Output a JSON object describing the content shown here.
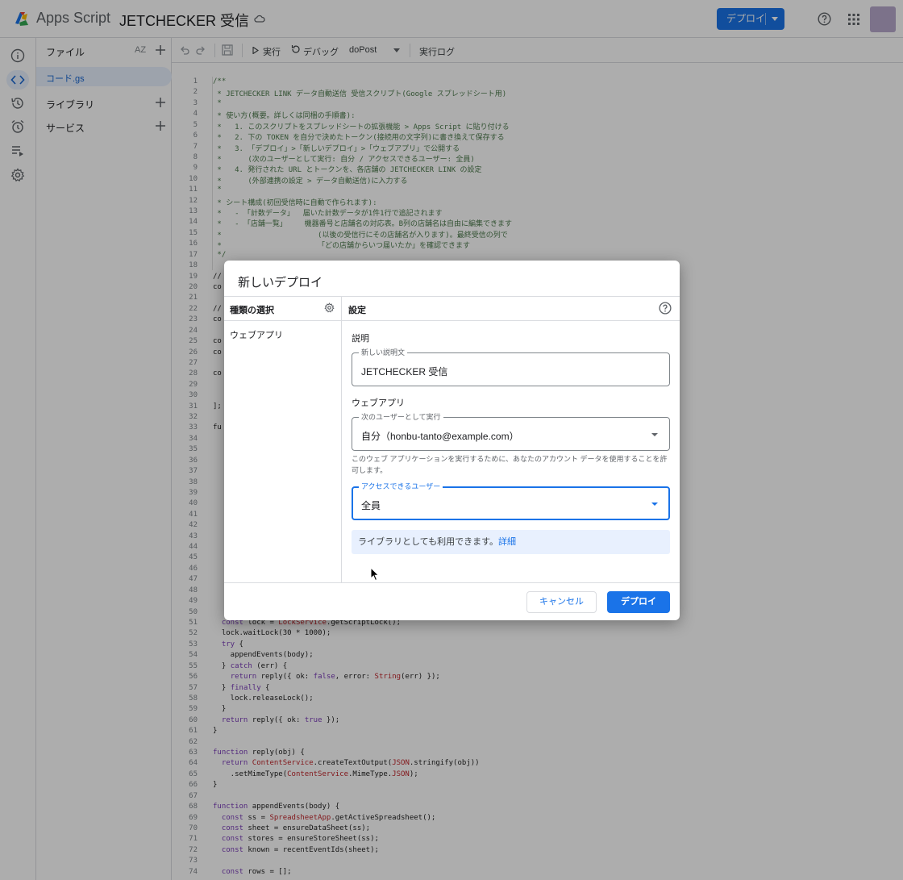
{
  "app": {
    "name": "Apps Script",
    "project_title": "JETCHECKER 受信"
  },
  "topbar": {
    "deploy_label": "デプロイ"
  },
  "file_panel": {
    "files_label": "ファイル",
    "sort_label": "AZ",
    "current_file": "コード.gs",
    "libraries_label": "ライブラリ",
    "services_label": "サービス"
  },
  "toolbar": {
    "run_label": "実行",
    "debug_label": "デバッグ",
    "function_name": "doPost",
    "log_label": "実行ログ"
  },
  "code": {
    "header_lines": [
      {
        "n": "1",
        "t": "/**"
      },
      {
        "n": "2",
        "t": " * JETCHECKER LINK データ自動送信 受信スクリプト(Google スプレッドシート用)"
      },
      {
        "n": "3",
        "t": " *"
      },
      {
        "n": "4",
        "t": " * 使い方(概要。詳しくは同梱の手順書):"
      },
      {
        "n": "5",
        "t": " *   1. このスクリプトをスプレッドシートの拡張機能 > Apps Script に貼り付ける"
      },
      {
        "n": "6",
        "t": " *   2. 下の TOKEN を自分で決めたトークン(接続用の文字列)に書き換えて保存する"
      },
      {
        "n": "7",
        "t": " *   3. 「デプロイ」>「新しいデプロイ」>「ウェブアプリ」で公開する"
      },
      {
        "n": "8",
        "t": " *      (次のユーザーとして実行: 自分 / アクセスできるユーザー: 全員)"
      },
      {
        "n": "9",
        "t": " *   4. 発行された URL とトークンを、各店舗の JETCHECKER LINK の設定"
      },
      {
        "n": "10",
        "t": " *      (外部連携の設定 > データ自動送信)に入力する"
      },
      {
        "n": "11",
        "t": " *"
      },
      {
        "n": "12",
        "t": " * シート構成(初回受信時に自動で作られます):"
      },
      {
        "n": "13",
        "t": " *   - 「計数データ」  届いた計数データが1件1行で追記されます"
      },
      {
        "n": "14",
        "t": " *   - 「店舗一覧」    機器番号と店舗名の対応表。B列の店舗名は自由に編集できます"
      },
      {
        "n": "15",
        "t": " *                      (以後の受信行にその店舗名が入ります)。最終受信の列で"
      },
      {
        "n": "16",
        "t": " *                      「どの店舗からいつ届いたか」を確認できます"
      },
      {
        "n": "17",
        "t": " */"
      }
    ],
    "partial_lines": [
      {
        "n": "18",
        "t": ""
      },
      {
        "n": "19",
        "t": "//"
      },
      {
        "n": "20",
        "t": "co"
      },
      {
        "n": "21",
        "t": ""
      },
      {
        "n": "22",
        "t": "//"
      },
      {
        "n": "23",
        "t": "co"
      },
      {
        "n": "24",
        "t": ""
      },
      {
        "n": "25",
        "t": "co"
      },
      {
        "n": "26",
        "t": "co"
      },
      {
        "n": "27",
        "t": ""
      },
      {
        "n": "28",
        "t": "co"
      },
      {
        "n": "29",
        "t": ""
      },
      {
        "n": "30",
        "t": ""
      },
      {
        "n": "31",
        "t": "];"
      },
      {
        "n": "32",
        "t": ""
      },
      {
        "n": "33",
        "t": "fu"
      },
      {
        "n": "34",
        "t": ""
      },
      {
        "n": "35",
        "t": ""
      },
      {
        "n": "36",
        "t": ""
      },
      {
        "n": "37",
        "t": ""
      },
      {
        "n": "38",
        "t": ""
      },
      {
        "n": "39",
        "t": ""
      },
      {
        "n": "40",
        "t": ""
      },
      {
        "n": "41",
        "t": ""
      },
      {
        "n": "42",
        "t": ""
      },
      {
        "n": "43",
        "t": ""
      },
      {
        "n": "44",
        "t": ""
      },
      {
        "n": "45",
        "t": ""
      },
      {
        "n": "46",
        "t": ""
      },
      {
        "n": "47",
        "t": ""
      },
      {
        "n": "48",
        "t": ""
      },
      {
        "n": "49",
        "t": ""
      },
      {
        "n": "50",
        "t": ""
      }
    ],
    "body_lines": [
      {
        "n": "51",
        "t": "  const lock = LockService.getScriptLock();"
      },
      {
        "n": "52",
        "t": "  lock.waitLock(30 * 1000);"
      },
      {
        "n": "53",
        "t": "  try {"
      },
      {
        "n": "54",
        "t": "    appendEvents(body);"
      },
      {
        "n": "55",
        "t": "  } catch (err) {"
      },
      {
        "n": "56",
        "t": "    return reply({ ok: false, error: String(err) });"
      },
      {
        "n": "57",
        "t": "  } finally {"
      },
      {
        "n": "58",
        "t": "    lock.releaseLock();"
      },
      {
        "n": "59",
        "t": "  }"
      },
      {
        "n": "60",
        "t": "  return reply({ ok: true });"
      },
      {
        "n": "61",
        "t": "}"
      },
      {
        "n": "62",
        "t": ""
      },
      {
        "n": "63",
        "t": "function reply(obj) {"
      },
      {
        "n": "64",
        "t": "  return ContentService.createTextOutput(JSON.stringify(obj))"
      },
      {
        "n": "65",
        "t": "    .setMimeType(ContentService.MimeType.JSON);"
      },
      {
        "n": "66",
        "t": "}"
      },
      {
        "n": "67",
        "t": ""
      },
      {
        "n": "68",
        "t": "function appendEvents(body) {"
      },
      {
        "n": "69",
        "t": "  const ss = SpreadsheetApp.getActiveSpreadsheet();"
      },
      {
        "n": "70",
        "t": "  const sheet = ensureDataSheet(ss);"
      },
      {
        "n": "71",
        "t": "  const stores = ensureStoreSheet(ss);"
      },
      {
        "n": "72",
        "t": "  const known = recentEventIds(sheet);"
      },
      {
        "n": "73",
        "t": ""
      },
      {
        "n": "74",
        "t": "  const rows = [];"
      }
    ]
  },
  "dialog": {
    "title": "新しいデプロイ",
    "type_header": "種類の選択",
    "type_item": "ウェブアプリ",
    "settings_header": "設定",
    "description_section": "説明",
    "description_label": "新しい説明文",
    "description_value": "JETCHECKER 受信",
    "webapp_section": "ウェブアプリ",
    "execute_as_label": "次のユーザーとして実行",
    "execute_as_value": "自分（honbu-tanto@example.com）",
    "execute_hint": "このウェブ アプリケーションを実行するために、あなたのアカウント データを使用することを許可します。",
    "access_label": "アクセスできるユーザー",
    "access_value": "全員",
    "library_note": "ライブラリとしても利用できます。",
    "library_link": "詳細",
    "cancel_label": "キャンセル",
    "deploy_label": "デプロイ"
  },
  "colors": {
    "accent": "#1a73e8",
    "scrim": "rgba(0,0,0,0.32)",
    "selected_bg": "#e8f0fe"
  },
  "icons": {
    "logo": "apps-script-logo",
    "cloud": "cloud-saved-icon",
    "help": "help-circle-icon",
    "apps": "apps-grid-icon",
    "rail": [
      "info-icon",
      "code-icon",
      "history-icon",
      "alarm-icon",
      "executions-icon",
      "gear-icon"
    ]
  }
}
